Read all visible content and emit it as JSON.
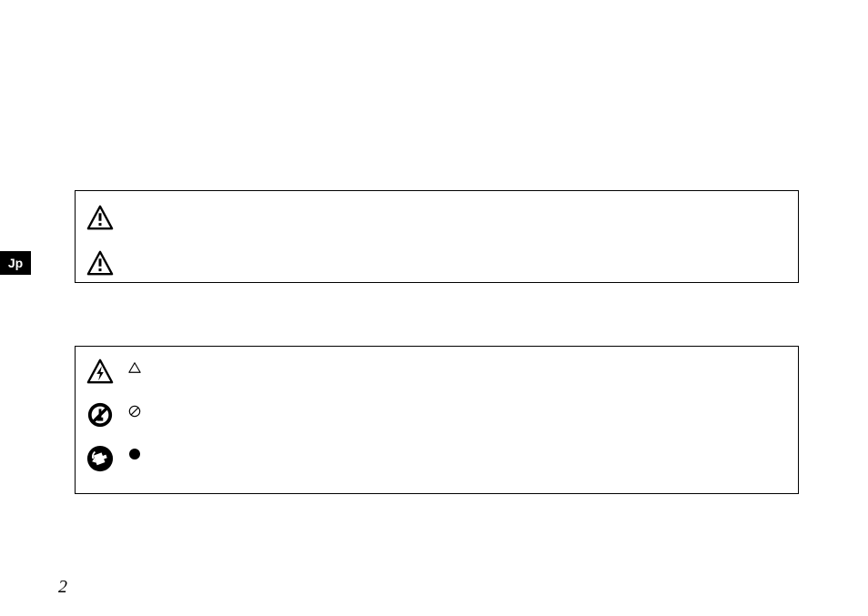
{
  "language_tab": "Jp",
  "page_number": "2",
  "box1": {
    "icons": [
      {
        "name": "warning-triangle-exclamation"
      },
      {
        "name": "warning-triangle-exclamation"
      }
    ]
  },
  "box2": {
    "large_icons": [
      {
        "name": "warning-triangle-lightning"
      },
      {
        "name": "prohibited-disassemble"
      },
      {
        "name": "mandatory-unplug"
      }
    ],
    "small_icons": [
      {
        "name": "triangle-outline"
      },
      {
        "name": "circle-slash-outline"
      },
      {
        "name": "filled-dot"
      }
    ]
  }
}
